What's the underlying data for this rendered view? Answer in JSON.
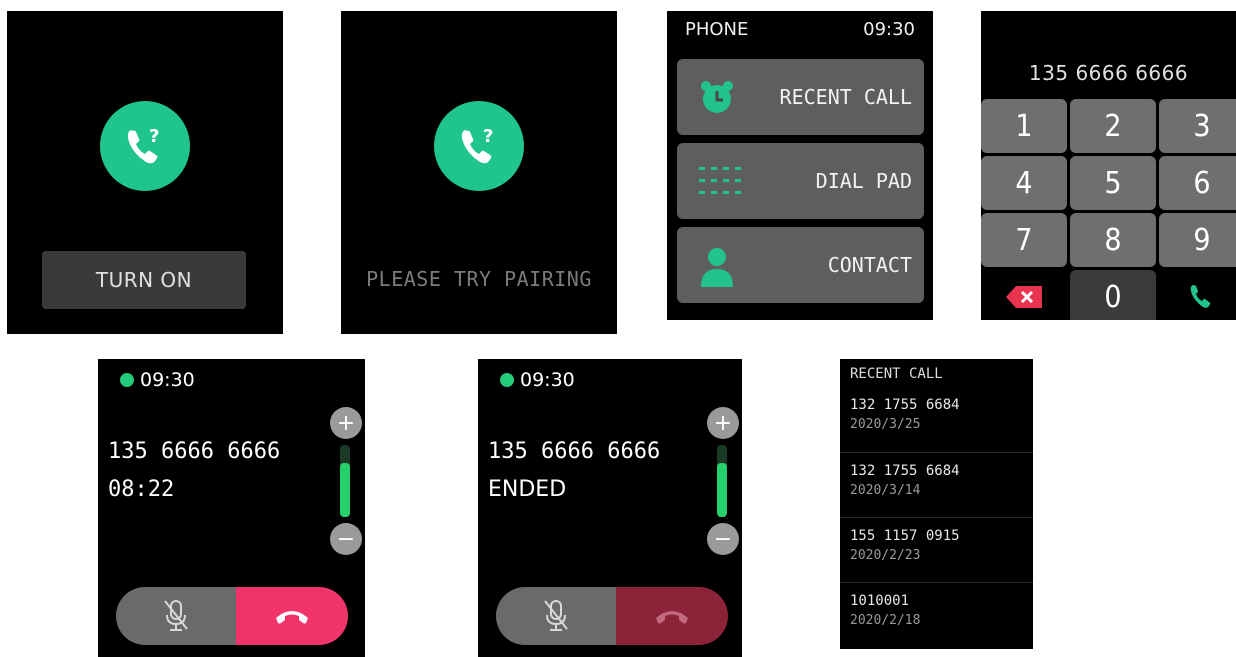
{
  "screen_turnon": {
    "button": "TURN ON"
  },
  "screen_pairing": {
    "message": "PLEASE TRY PAIRING"
  },
  "screen_menu": {
    "title": "PHONE",
    "time": "09:30",
    "items": [
      {
        "label": "RECENT CALL",
        "icon": "alarm-clock-icon"
      },
      {
        "label": "DIAL PAD",
        "icon": "dialpad-icon"
      },
      {
        "label": "CONTACT",
        "icon": "person-icon"
      }
    ]
  },
  "screen_dialpad": {
    "number": "135 6666 6666",
    "keys": [
      "1",
      "2",
      "3",
      "4",
      "5",
      "6",
      "7",
      "8",
      "9",
      "0"
    ]
  },
  "screen_incall": {
    "time": "09:30",
    "number": "135 6666 6666",
    "status": "08:22",
    "volume_level": 0.75
  },
  "screen_ended": {
    "time": "09:30",
    "number": "135 6666 6666",
    "status": "ENDED",
    "volume_level": 0.75
  },
  "screen_recent": {
    "title": "RECENT CALL",
    "items": [
      {
        "number": "132 1755 6684",
        "date": "2020/3/25"
      },
      {
        "number": "132 1755 6684",
        "date": "2020/3/14"
      },
      {
        "number": "155 1157 0915",
        "date": "2020/2/23"
      },
      {
        "number": "1010001",
        "date": "2020/2/18"
      }
    ]
  },
  "colors": {
    "accent_green": "#20c48f",
    "hangup_red": "#f0346b",
    "hangup_dim": "#8a2238"
  }
}
